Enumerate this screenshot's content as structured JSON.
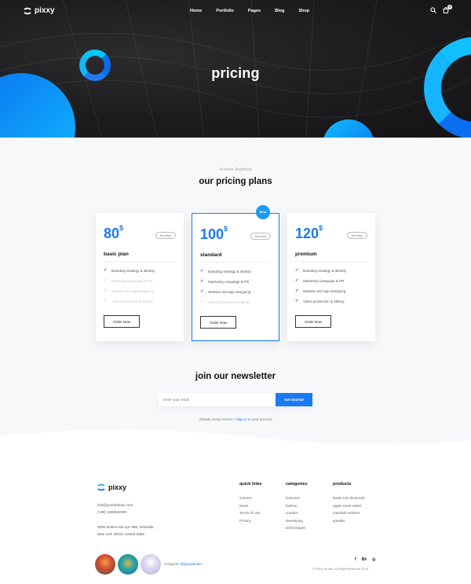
{
  "header": {
    "brand": "pixxy",
    "nav": [
      {
        "label": "Home"
      },
      {
        "label": "Portfolio"
      },
      {
        "label": "Pages"
      },
      {
        "label": "Blog"
      },
      {
        "label": "Shop"
      }
    ],
    "cart_count": "0",
    "icons": [
      "search-icon",
      "cart-icon"
    ]
  },
  "hero": {
    "title": "pricing"
  },
  "pricing": {
    "eyebrow": "Answer Anything",
    "title": "our pricing plans",
    "best_badge": "Best",
    "currency": "$",
    "plans": [
      {
        "price": "80",
        "period": "Monthly",
        "name": "basic plan",
        "features": [
          {
            "label": "Branding strategy & identity",
            "included": true
          },
          {
            "label": "Marketing campaign & PR",
            "included": false
          },
          {
            "label": "Website and app designing",
            "included": false
          },
          {
            "label": "Video production & editing",
            "included": false
          }
        ],
        "button": "Order Now"
      },
      {
        "price": "100",
        "period": "Monthly",
        "name": "standard",
        "features": [
          {
            "label": "Branding strategy & identity",
            "included": true
          },
          {
            "label": "Marketing campaign & PR",
            "included": true
          },
          {
            "label": "Website and app designing",
            "included": true
          },
          {
            "label": "Video production & editing",
            "included": false
          }
        ],
        "button": "Order Now"
      },
      {
        "price": "120",
        "period": "Monthly",
        "name": "premium",
        "features": [
          {
            "label": "Branding strategy & identity",
            "included": true
          },
          {
            "label": "Marketing campaign & PR",
            "included": true
          },
          {
            "label": "Website and app designing",
            "included": true
          },
          {
            "label": "Video production & editing",
            "included": true
          }
        ],
        "button": "Order Now"
      }
    ]
  },
  "newsletter": {
    "title": "join our newsletter",
    "placeholder": "Enter your email",
    "button": "Get Started",
    "signin_prefix": "Already using Arcena ?",
    "signin_link": "Sign in",
    "signin_suffix": "to your account"
  },
  "footer": {
    "brand": "pixxy",
    "email": "info@yourdomain.com",
    "phone": "(+88) 1200034509",
    "address1": "2005 Stokes Isle Apt. 896, Venaville,",
    "address2": "New York 10010, United State",
    "columns": [
      {
        "title": "quick links",
        "links": [
          "Careers",
          "News",
          "Terms of Use",
          "Privacy"
        ]
      },
      {
        "title": "categories",
        "links": [
          "business",
          "fashion",
          "creative",
          "developing",
          "technologies"
        ]
      },
      {
        "title": "products",
        "links": [
          "beats solo bluetooth",
          "apple smart watch",
          "marshall wireless",
          "speaker"
        ]
      }
    ],
    "instagram_label": "instagram",
    "instagram_handle": "@pixxystudio",
    "socials": [
      "f",
      "Bē",
      "◎"
    ],
    "social_icons": [
      "facebook-icon",
      "behance-icon",
      "dribbble-icon"
    ],
    "copyright": "© Pixxy Studio. All Right Reserved 2016"
  },
  "colors": {
    "accent": "#1a7af2",
    "hero_bg": "#1c1c1e",
    "section_bg": "#f7f8fa"
  }
}
